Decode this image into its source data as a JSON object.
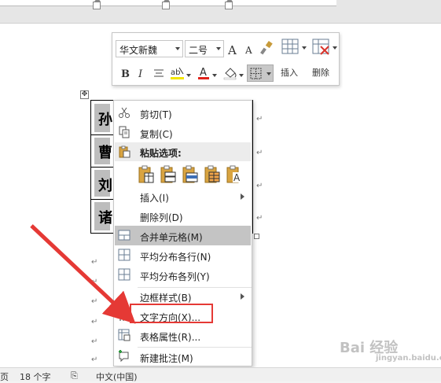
{
  "mini_toolbar": {
    "font_name": "华文新魏",
    "font_size": "二号",
    "grow_font": "A",
    "shrink_font": "A",
    "bold": "B",
    "italic": "I",
    "insert_label": "插入",
    "delete_label": "删除"
  },
  "table": {
    "cells": [
      "孙",
      "曹",
      "刘",
      "诸"
    ]
  },
  "context_menu": {
    "items": [
      {
        "label": "剪切(T)",
        "icon": "scissors-icon"
      },
      {
        "label": "复制(C)",
        "icon": "copy-icon"
      },
      {
        "label": "粘贴选项:",
        "icon": "paste-icon"
      },
      {
        "label": "插入(I)",
        "icon": "none"
      },
      {
        "label": "删除列(D)",
        "icon": "none"
      },
      {
        "label": "合并单元格(M)",
        "icon": "merge-cells-icon"
      },
      {
        "label": "平均分布各行(N)",
        "icon": "distribute-rows-icon"
      },
      {
        "label": "平均分布各列(Y)",
        "icon": "distribute-columns-icon"
      },
      {
        "label": "边框样式(B)",
        "icon": "none"
      },
      {
        "label": "文字方向(X)...",
        "icon": "text-direction-icon"
      },
      {
        "label": "表格属性(R)...",
        "icon": "table-properties-icon"
      },
      {
        "label": "新建批注(M)",
        "icon": "new-comment-icon"
      }
    ]
  },
  "status_bar": {
    "page": "页",
    "word_count": "18 个字",
    "language": "中文(中国)"
  },
  "watermark": {
    "text": "Bai 经验",
    "sub": "jingyan.baidu.com"
  },
  "colors": {
    "highlight_box": "#e53935",
    "arrow": "#e53935",
    "menu_hover": "#c4c4c4"
  }
}
